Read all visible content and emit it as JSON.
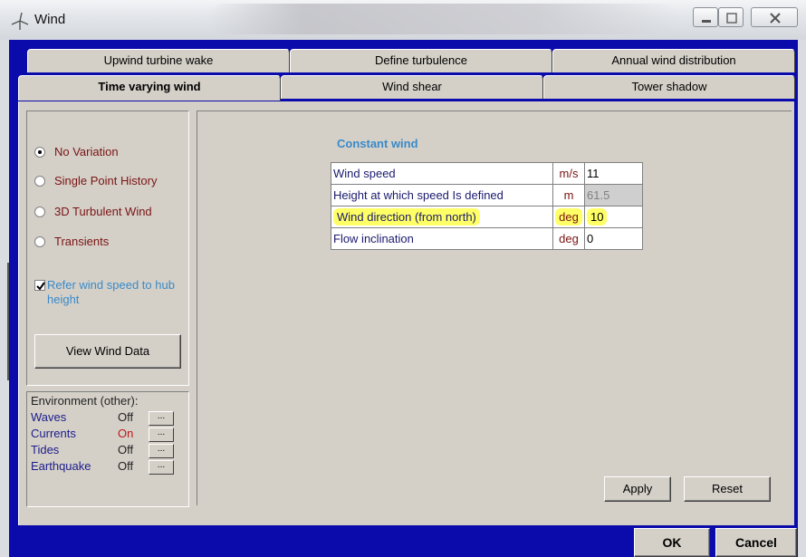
{
  "window": {
    "title": "Wind",
    "controls": {
      "minimize_icon": "minimize-icon",
      "maximize_icon": "maximize-icon",
      "close_icon": "close-icon"
    }
  },
  "tabs": {
    "row1": [
      "Upwind turbine wake",
      "Define turbulence",
      "Annual wind distribution"
    ],
    "row2": [
      "Time varying wind",
      "Wind shear",
      "Tower shadow"
    ],
    "active": "Time varying wind"
  },
  "left": {
    "radios": [
      {
        "label": "No Variation",
        "selected": true
      },
      {
        "label": "Single Point History",
        "selected": false
      },
      {
        "label": "3D Turbulent Wind",
        "selected": false
      },
      {
        "label": "Transients",
        "selected": false
      }
    ],
    "refer_checkbox": {
      "label": "Refer wind speed to hub height",
      "checked": true
    },
    "view_wind_button": "View Wind Data"
  },
  "environment": {
    "title": "Environment (other):",
    "rows": [
      {
        "name": "Waves",
        "value": "Off",
        "button": "..."
      },
      {
        "name": "Currents",
        "value": "On",
        "button": "..."
      },
      {
        "name": "Tides",
        "value": "Off",
        "button": "..."
      },
      {
        "name": "Earthquake",
        "value": "Off",
        "button": "..."
      }
    ]
  },
  "constant_wind": {
    "title": "Constant wind",
    "rows": [
      {
        "name": "Wind speed",
        "unit": "m/s",
        "value": "11",
        "disabled": false,
        "highlight": false
      },
      {
        "name": "Height at which speed Is defined",
        "unit": "m",
        "value": "61.5",
        "disabled": true,
        "highlight": false
      },
      {
        "name": "Wind direction (from north)",
        "unit": "deg",
        "value": "10",
        "disabled": false,
        "highlight": true
      },
      {
        "name": "Flow inclination",
        "unit": "deg",
        "value": "0",
        "disabled": false,
        "highlight": false
      }
    ]
  },
  "buttons": {
    "apply": "Apply",
    "reset": "Reset",
    "ok": "OK",
    "cancel": "Cancel"
  },
  "colors": {
    "dialog_background": "#0b0bab",
    "panel_face": "#d4d0c8",
    "label_red": "#7a1414",
    "accent_blue": "#3a8ac8",
    "highlight_yellow": "#ffff66"
  }
}
